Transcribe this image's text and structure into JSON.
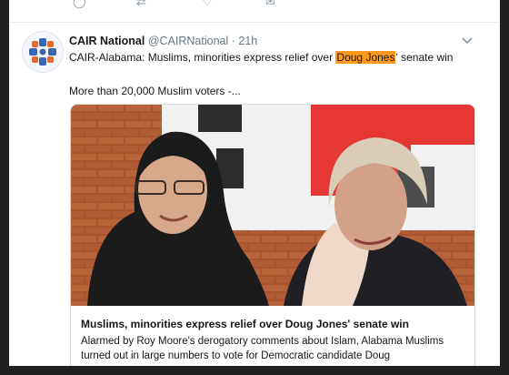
{
  "tweet": {
    "author_name": "CAIR National",
    "author_handle": "@CAIRNational",
    "separator": "·",
    "time": "21h",
    "text_before": "CAIR-Alabama: Muslims, minorities express relief over ",
    "text_highlight": "Doug Jones",
    "text_after": "' senate win",
    "text_more": "More than 20,000 Muslim voters -...",
    "avatar_icon": "cair-logo-icon",
    "menu_icon": "chevron-down-icon"
  },
  "card": {
    "title": "Muslims, minorities express relief over Doug Jones' senate win",
    "description": "Alarmed by Roy Moore's derogatory comments about Islam, Alabama Muslims turned out in large numbers to vote for Democratic candidate Doug",
    "image_icon": "article-photo"
  },
  "colors": {
    "highlight": "#ff9a1f",
    "muted": "#657786",
    "border": "#d6dee4"
  }
}
